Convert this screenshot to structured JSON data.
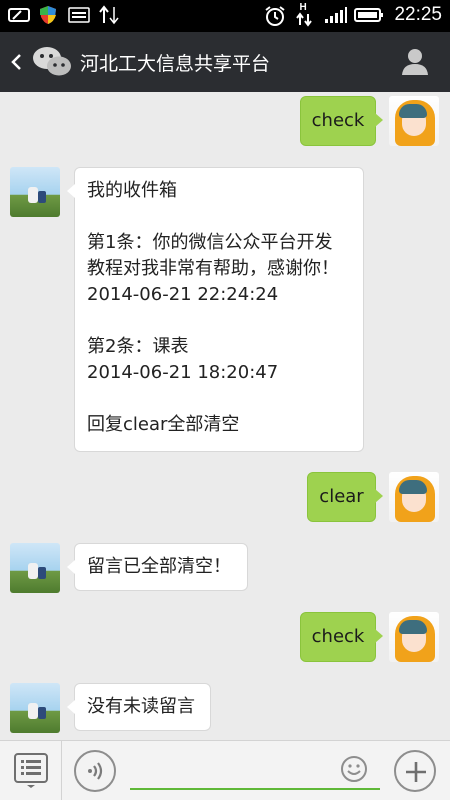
{
  "status_bar": {
    "time": "22:25",
    "network_label": "H",
    "left_icons": [
      "screen-cast-icon",
      "shield-icon",
      "keyboard-icon",
      "transfer-icon"
    ],
    "right_icons": [
      "alarm-icon",
      "data-arrows-icon",
      "signal-icon",
      "battery-icon"
    ]
  },
  "header": {
    "title": "河北工大信息共享平台",
    "back_icon": "chevron-left-icon",
    "logo_icon": "wechat-logo-icon",
    "profile_icon": "person-icon"
  },
  "messages": [
    {
      "from": "user",
      "text": "check"
    },
    {
      "from": "bot",
      "text": "我的收件箱\n\n第1条：你的微信公众平台开发\n教程对我非常有帮助，感谢你！\n2014-06-21 22:24:24\n\n第2条：课表\n2014-06-21 18:20:47\n\n回复clear全部清空"
    },
    {
      "from": "user",
      "text": "clear"
    },
    {
      "from": "bot",
      "text": "留言已全部清空！"
    },
    {
      "from": "user",
      "text": "check"
    },
    {
      "from": "bot",
      "text": "没有未读留言"
    }
  ],
  "input_bar": {
    "menu_icon": "menu-list-icon",
    "voice_icon": "voice-icon",
    "emoji_icon": "emoji-icon",
    "plus_icon": "plus-icon"
  },
  "colors": {
    "header_bg": "#2b2d31",
    "outgoing_bubble": "#9ed24f",
    "incoming_bubble": "#ffffff",
    "chat_bg": "#ebebeb",
    "input_underline": "#5fb838"
  }
}
